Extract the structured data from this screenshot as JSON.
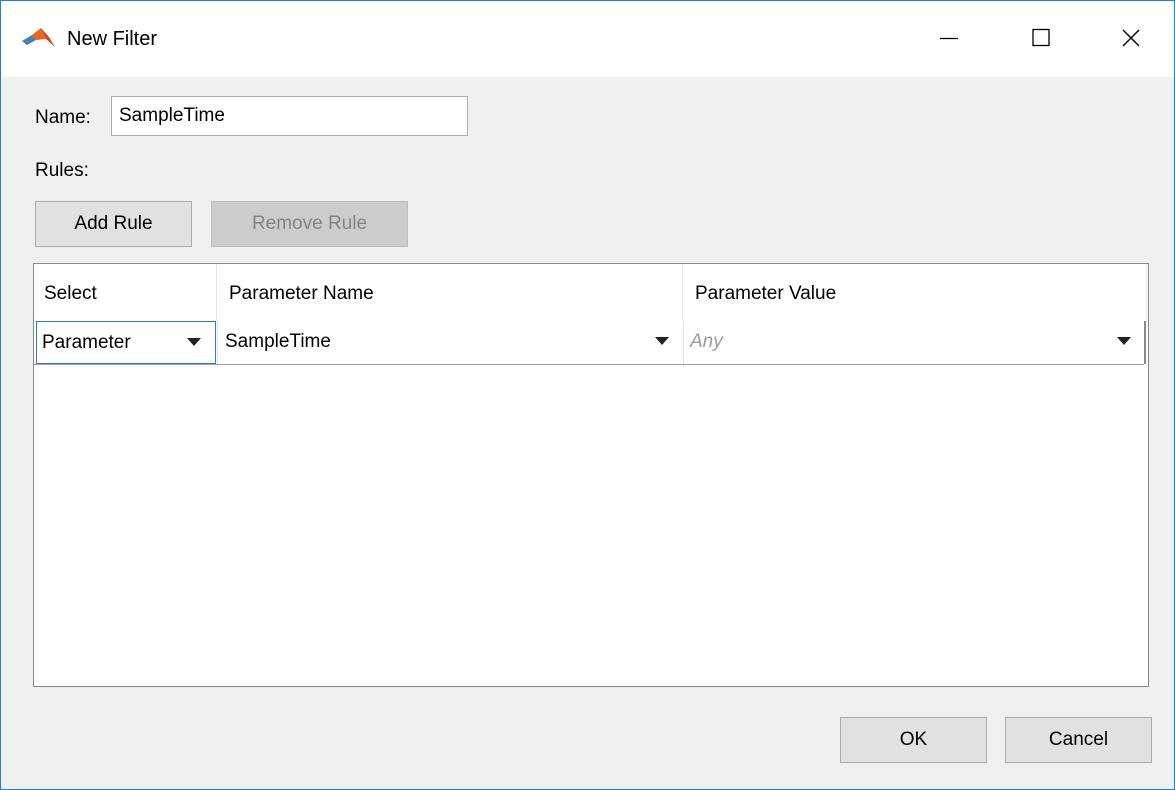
{
  "window": {
    "title": "New Filter",
    "icon": "matlab-logo-icon",
    "controls": {
      "minimize": "minimize-icon",
      "maximize": "maximize-icon",
      "close": "close-icon"
    }
  },
  "form": {
    "name_label": "Name:",
    "name_value": "SampleTime",
    "rules_label": "Rules:"
  },
  "toolbar": {
    "add_rule_label": "Add Rule",
    "remove_rule_label": "Remove Rule"
  },
  "table": {
    "columns": [
      "Select",
      "Parameter Name",
      "Parameter Value"
    ],
    "rows": [
      {
        "select": "Parameter",
        "parameter_name": "SampleTime",
        "parameter_value": "Any"
      }
    ]
  },
  "footer": {
    "ok_label": "OK",
    "cancel_label": "Cancel"
  },
  "colors": {
    "accent": "#1883d7",
    "selection_border": "#2b79d8",
    "dialog_bg": "#f0f0f0"
  }
}
